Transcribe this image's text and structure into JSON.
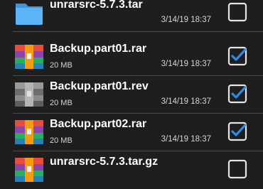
{
  "files": [
    {
      "name": "unrarsrc-5.7.3.tar",
      "size": "",
      "date": "3/14/19 18:37",
      "icon": "folder-icon",
      "checked": false
    },
    {
      "name": "Backup.part01.rar",
      "size": "20 MB",
      "date": "3/14/19 18:37",
      "icon": "rar-archive-icon",
      "checked": true
    },
    {
      "name": "Backup.part01.rev",
      "size": "20 MB",
      "date": "3/14/19 18:37",
      "icon": "rev-archive-icon",
      "checked": true
    },
    {
      "name": "Backup.part02.rar",
      "size": "20 MB",
      "date": "3/14/19 18:37",
      "icon": "rar-archive-icon",
      "checked": true
    },
    {
      "name": "unrarsrc-5.7.3.tar.gz",
      "size": "",
      "date": "",
      "icon": "rar-archive-icon",
      "checked": false
    }
  ],
  "colors": {
    "background": "#1e1e1e",
    "accent": "#2a8be8",
    "folder": "#4aa8ef"
  }
}
